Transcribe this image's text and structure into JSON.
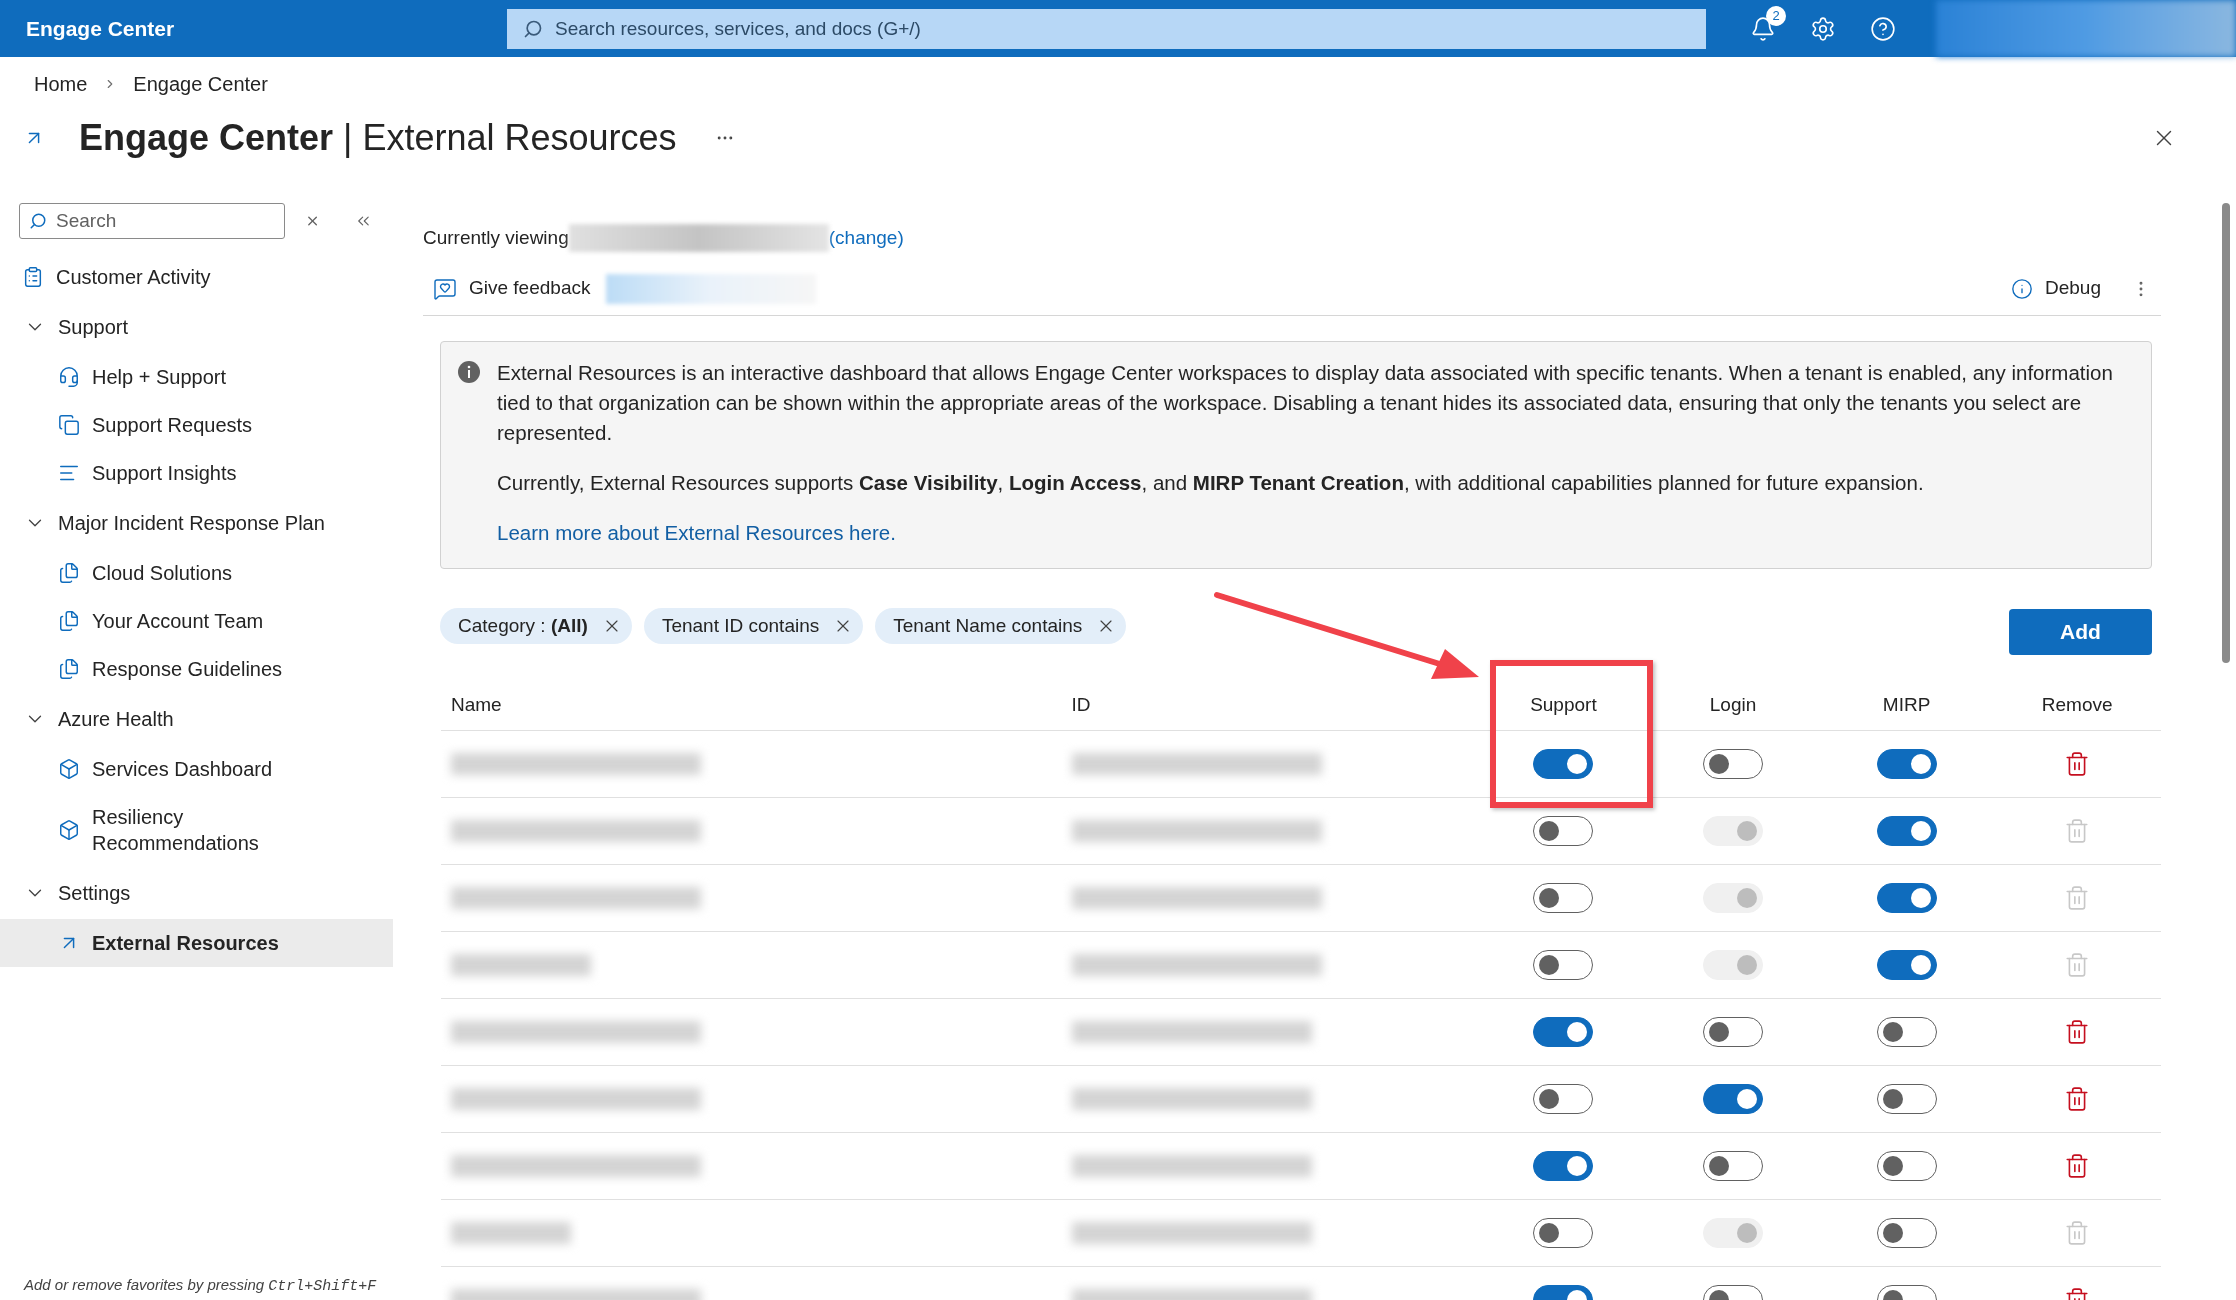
{
  "top_bar": {
    "title": "Engage Center",
    "search": {
      "placeholder": "Search resources, services, and docs (G+/)"
    },
    "notification_count": "2"
  },
  "breadcrumb": [
    "Home",
    "Engage Center"
  ],
  "page": {
    "title_bold": "Engage Center",
    "title_rest": "| External Resources"
  },
  "sidebar": {
    "search": {
      "placeholder": "Search"
    },
    "items": [
      {
        "kind": "activity",
        "label": "Customer Activity",
        "selected": false
      },
      {
        "kind": "group",
        "label": "Support",
        "expanded": true,
        "children": [
          {
            "kind": "headset",
            "label": "Help + Support",
            "selected": false
          },
          {
            "kind": "requests",
            "label": "Support Requests",
            "selected": false
          },
          {
            "kind": "insights",
            "label": "Support Insights",
            "selected": false
          }
        ]
      },
      {
        "kind": "group",
        "label": "Major Incident Response Plan",
        "expanded": true,
        "children": [
          {
            "kind": "document",
            "label": "Cloud Solutions",
            "selected": false
          },
          {
            "kind": "document",
            "label": "Your Account Team",
            "selected": false
          },
          {
            "kind": "document",
            "label": "Response Guidelines",
            "selected": false
          }
        ]
      },
      {
        "kind": "group",
        "label": "Azure Health",
        "expanded": true,
        "children": [
          {
            "kind": "cube",
            "label": "Services Dashboard",
            "selected": false
          },
          {
            "kind": "cube",
            "label": "Resiliency Recommendations",
            "selected": false
          }
        ]
      },
      {
        "kind": "group",
        "label": "Settings",
        "expanded": true,
        "children": [
          {
            "kind": "external",
            "label": "External Resources",
            "selected": true
          }
        ]
      }
    ],
    "footer": {
      "text": "Add or remove favorites by pressing",
      "shortcut": "Ctrl+Shift+F"
    }
  },
  "viewing": {
    "label": "Currently viewing",
    "link": "(change)"
  },
  "toolbar": {
    "feedback": "Give feedback",
    "debug": "Debug"
  },
  "info": {
    "paragraphs": [
      "External Resources is an interactive dashboard that allows Engage Center workspaces to display data associated with specific tenants. When a tenant is enabled, any information tied to that organization can be shown within the appropriate areas of the workspace. Disabling a tenant hides its associated data, ensuring that only the tenants you select are represented.",
      "Currently, External Resources supports **Case Visibility**, **Login Access**, and **MIRP Tenant Creation**, with additional capabilities planned for future expansion."
    ],
    "link": "Learn more about External Resources here."
  },
  "filters": [
    {
      "label": "Category : **(All)**"
    },
    {
      "label": "Tenant ID contains"
    },
    {
      "label": "Tenant Name contains"
    }
  ],
  "add_button": "Add",
  "table": {
    "columns": [
      {
        "label": "Name",
        "highlighted": false
      },
      {
        "label": "ID",
        "highlighted": false
      },
      {
        "label": "Support",
        "highlighted": true
      },
      {
        "label": "Login",
        "highlighted": false
      },
      {
        "label": "MIRP",
        "highlighted": false
      },
      {
        "label": "Remove",
        "highlighted": false
      }
    ],
    "rows": [
      {
        "support": {
          "on": true
        },
        "login": {
          "on": false,
          "disabled": false
        },
        "mirp": {
          "on": true
        },
        "remove": {
          "disabled": false
        }
      },
      {
        "support": {
          "on": false
        },
        "login": {
          "on": true,
          "disabled": true
        },
        "mirp": {
          "on": true
        },
        "remove": {
          "disabled": true
        }
      },
      {
        "support": {
          "on": false
        },
        "login": {
          "on": true,
          "disabled": true
        },
        "mirp": {
          "on": true
        },
        "remove": {
          "disabled": true
        }
      },
      {
        "support": {
          "on": false
        },
        "login": {
          "on": true,
          "disabled": true
        },
        "mirp": {
          "on": true
        },
        "remove": {
          "disabled": true
        }
      },
      {
        "support": {
          "on": true
        },
        "login": {
          "on": false,
          "disabled": false
        },
        "mirp": {
          "on": false
        },
        "remove": {
          "disabled": false
        }
      },
      {
        "support": {
          "on": false
        },
        "login": {
          "on": true,
          "disabled": false
        },
        "mirp": {
          "on": false
        },
        "remove": {
          "disabled": false
        }
      },
      {
        "support": {
          "on": true
        },
        "login": {
          "on": false,
          "disabled": false
        },
        "mirp": {
          "on": false
        },
        "remove": {
          "disabled": false
        }
      },
      {
        "support": {
          "on": false
        },
        "login": {
          "on": true,
          "disabled": true
        },
        "mirp": {
          "on": false
        },
        "remove": {
          "disabled": true
        }
      },
      {
        "support": {
          "on": true
        },
        "login": {
          "on": false,
          "disabled": false
        },
        "mirp": {
          "on": false
        },
        "remove": {
          "disabled": false
        }
      }
    ]
  }
}
